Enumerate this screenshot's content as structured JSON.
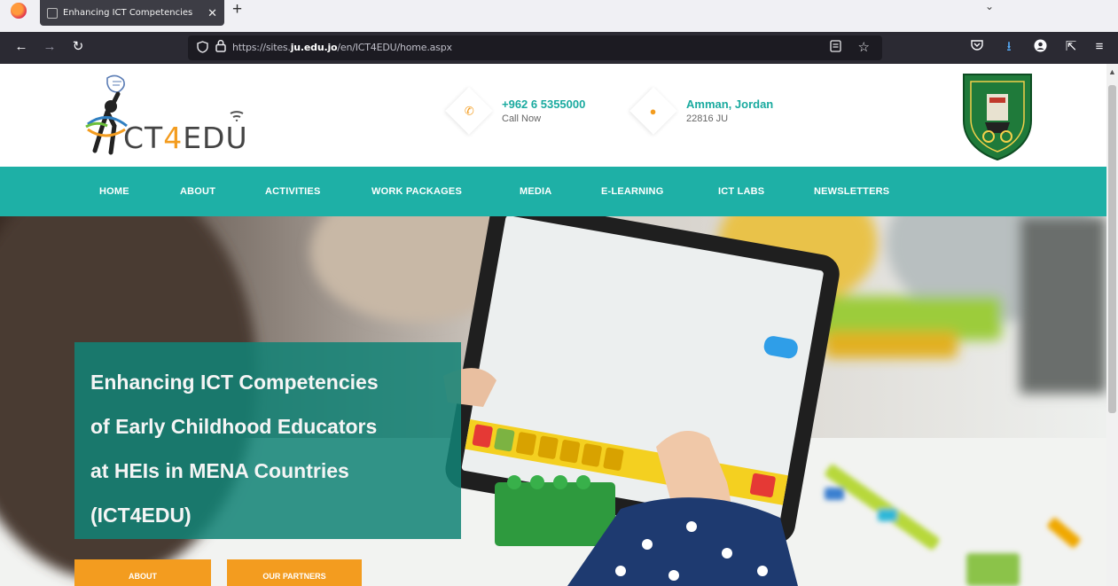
{
  "browser": {
    "tab_title": "Enhancing ICT Competencies",
    "tab_close": "✕",
    "new_tab": "+",
    "tab_list": "⌄",
    "url_prefix": "https://sites.",
    "url_domain": "ju.edu.jo",
    "url_path": "/en/ICT4EDU/home.aspx"
  },
  "header": {
    "logo_prefix": "CT",
    "logo_four": "4",
    "logo_suffix": "EDU",
    "phone": {
      "icon": "phone-icon",
      "title": "+962 6 5355000",
      "sub": "Call Now"
    },
    "location": {
      "icon": "location-pin-icon",
      "title": "Amman, Jordan",
      "sub": "22816 JU"
    }
  },
  "nav": {
    "items": [
      "HOME",
      "ABOUT",
      "ACTIVITIES",
      "WORK PACKAGES",
      "MEDIA",
      "E-LEARNING",
      "ICT LABS",
      "NEWSLETTERS"
    ]
  },
  "hero": {
    "title_lines": [
      "Enhancing ICT Competencies",
      "of Early Childhood Educators",
      "at HEIs in MENA Countries",
      "(ICT4EDU)"
    ],
    "buttons": [
      "ABOUT",
      "OUR PARTNERS"
    ]
  },
  "colors": {
    "teal": "#1eb0a6",
    "orange": "#f39c1f",
    "toolbar": "#2b2a33"
  }
}
